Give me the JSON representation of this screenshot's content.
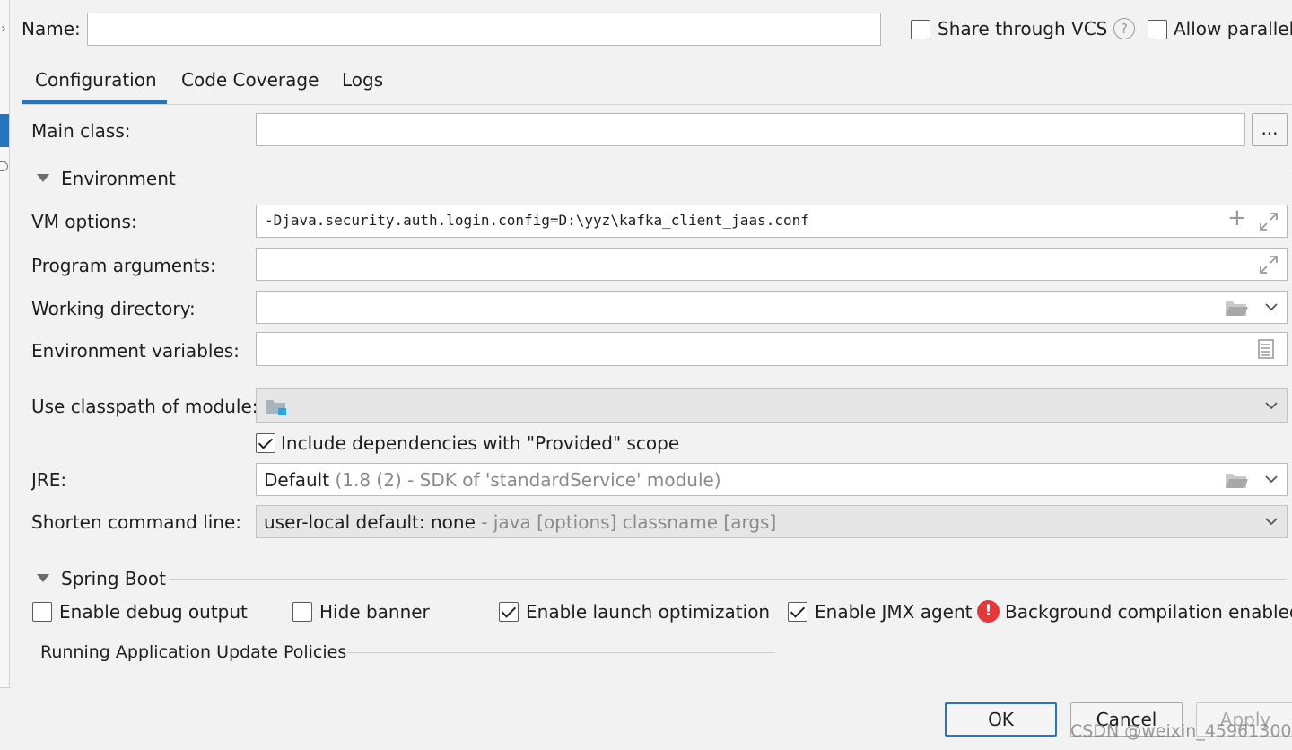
{
  "header": {
    "name_label": "Name:",
    "name_value": "",
    "share_vcs_label": "Share through VCS",
    "allow_parallel_label": "Allow parallel"
  },
  "tabs": [
    {
      "label": "Configuration",
      "active": true
    },
    {
      "label": "Code Coverage",
      "active": false
    },
    {
      "label": "Logs",
      "active": false
    }
  ],
  "main_class": {
    "label": "Main class:",
    "value": "",
    "browse_label": "..."
  },
  "environment": {
    "section_label": "Environment",
    "vm_options": {
      "label": "VM options:",
      "value": "-Djava.security.auth.login.config=D:\\yyz\\kafka_client_jaas.conf"
    },
    "program_arguments": {
      "label": "Program arguments:",
      "value": ""
    },
    "working_directory": {
      "label": "Working directory:",
      "value": ""
    },
    "environment_variables": {
      "label": "Environment variables:",
      "value": ""
    }
  },
  "classpath": {
    "label": "Use classpath of module:",
    "value": "",
    "include_provided_label": "Include dependencies with \"Provided\" scope",
    "include_provided_checked": true
  },
  "jre": {
    "label": "JRE:",
    "value_main": "Default",
    "value_detail": "(1.8 (2) - SDK of 'standardService' module)"
  },
  "shorten": {
    "label": "Shorten command line:",
    "value_main": "user-local default: none",
    "value_detail": "- java [options] classname [args]"
  },
  "spring_boot": {
    "section_label": "Spring Boot",
    "enable_debug_output": {
      "label": "Enable debug output",
      "checked": false
    },
    "hide_banner": {
      "label": "Hide banner",
      "checked": false
    },
    "enable_launch_optimization": {
      "label": "Enable launch optimization",
      "checked": true
    },
    "enable_jmx_agent": {
      "label": "Enable JMX agent",
      "checked": true
    },
    "warning_text": "Background compilation enabled",
    "policies_label": "Running Application Update Policies"
  },
  "footer": {
    "ok_label": "OK",
    "cancel_label": "Cancel",
    "apply_label": "Apply",
    "watermark": "CSDN @weixin_45961300"
  },
  "colors": {
    "accent": "#2675bf",
    "error": "#e5383b"
  }
}
